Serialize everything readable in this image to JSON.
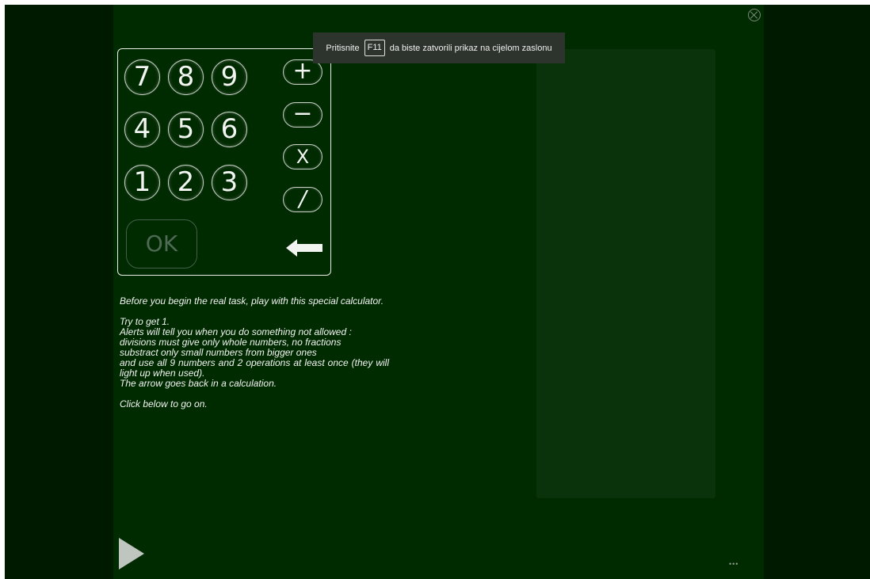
{
  "fullscreen_notice": {
    "prefix": "Pritisnite",
    "key": "F11",
    "suffix": "da biste zatvorili prikaz na cijelom zaslonu"
  },
  "calculator": {
    "number_keys": [
      "7",
      "8",
      "9",
      "4",
      "5",
      "6",
      "1",
      "2",
      "3"
    ],
    "operator_keys": [
      "+",
      "−",
      "X",
      "/"
    ],
    "ok_label": "OK",
    "back_arrow_icon": "left-arrow-icon"
  },
  "instructions": {
    "intro": "Before you begin the real task, play with this special calculator.",
    "goal": "Try to get 1.",
    "alerts": "Alerts will tell you when you do something not allowed :",
    "rule_divisions": "divisions must give only whole numbers, no fractions",
    "rule_subtract": "substract only small numbers from bigger ones",
    "rule_use_all": "and use all 9 numbers and 2 operations at least once (they will light up when used).",
    "arrow_note": "The arrow goes back in a calculation.",
    "click_below": "Click below to go on."
  },
  "controls": {
    "play_icon": "play-icon",
    "close_icon": "close-icon",
    "menu_dots": "•••"
  },
  "colors": {
    "background": "#002a00",
    "outer": "#001a00",
    "panel": "#0b330b",
    "key_text": "#f2f4f2",
    "ok_disabled": "#4f6a55"
  }
}
